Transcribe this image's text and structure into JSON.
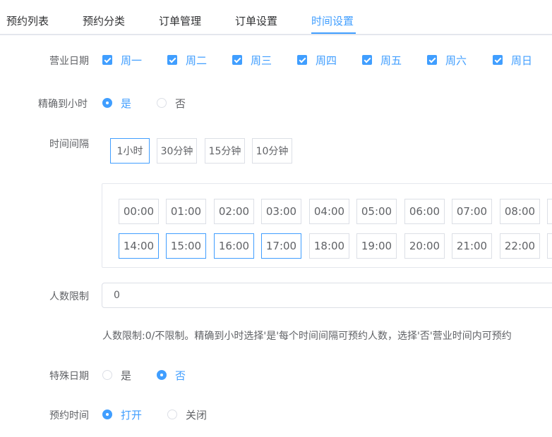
{
  "tabs": [
    {
      "label": "预约列表",
      "active": false
    },
    {
      "label": "预约分类",
      "active": false
    },
    {
      "label": "订单管理",
      "active": false
    },
    {
      "label": "订单设置",
      "active": false
    },
    {
      "label": "时间设置",
      "active": true
    }
  ],
  "colors": {
    "accent": "#409eff",
    "text": "#606266",
    "border": "#dcdfe6"
  },
  "business_days": {
    "label": "营业日期",
    "days": [
      "周一",
      "周二",
      "周三",
      "周四",
      "周五",
      "周六",
      "周日"
    ]
  },
  "precise_hour": {
    "label": "精确到小时",
    "options": [
      "是",
      "否"
    ],
    "selected": "是"
  },
  "interval": {
    "label": "时间间隔",
    "options": [
      "1小时",
      "30分钟",
      "15分钟",
      "10分钟"
    ],
    "selected": "1小时"
  },
  "time_slots": {
    "row1": [
      "00:00",
      "01:00",
      "02:00",
      "03:00",
      "04:00",
      "05:00",
      "06:00",
      "07:00",
      "08:00"
    ],
    "row2": [
      "14:00",
      "15:00",
      "16:00",
      "17:00",
      "18:00",
      "19:00",
      "20:00",
      "21:00",
      "22:00"
    ],
    "selected": [
      "14:00",
      "15:00",
      "16:00",
      "17:00"
    ]
  },
  "people_limit": {
    "label": "人数限制",
    "value": "0",
    "help": "人数限制:0/不限制。精确到小时选择'是'每个时间间隔可预约人数，选择'否'营业时间内可预约"
  },
  "special_date": {
    "label": "特殊日期",
    "options": [
      "是",
      "否"
    ],
    "selected": "否"
  },
  "booking_time": {
    "label": "预约时间",
    "options": [
      "打开",
      "关闭"
    ],
    "selected": "打开"
  }
}
